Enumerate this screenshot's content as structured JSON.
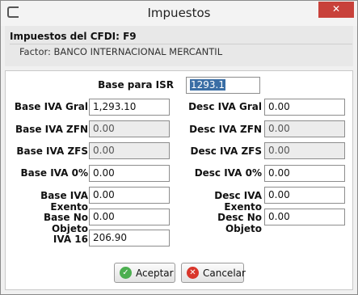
{
  "window": {
    "title": "Impuestos",
    "close_glyph": "✕"
  },
  "header": {
    "title": "Impuestos del CFDI: F9",
    "factor": "Factor: BANCO INTERNACIONAL MERCANTIL"
  },
  "form": {
    "base_isr": {
      "label": "Base para ISR",
      "value": "1293.1"
    },
    "left": [
      {
        "label": "Base IVA Gral",
        "value": "1,293.10",
        "enabled": true
      },
      {
        "label": "Base IVA ZFN",
        "value": "0.00",
        "enabled": false
      },
      {
        "label": "Base IVA ZFS",
        "value": "0.00",
        "enabled": false
      },
      {
        "label": "Base IVA 0%",
        "value": "0.00",
        "enabled": true
      },
      {
        "label": "Base IVA Exento",
        "value": "0.00",
        "enabled": true
      },
      {
        "label": "Base No Objeto",
        "value": "0.00",
        "enabled": true
      },
      {
        "label": "IVA 16",
        "value": "206.90",
        "enabled": true
      }
    ],
    "right": [
      {
        "label": "Desc IVA Gral",
        "value": "0.00",
        "enabled": true
      },
      {
        "label": "Desc IVA ZFN",
        "value": "0.00",
        "enabled": false
      },
      {
        "label": "Desc IVA ZFS",
        "value": "0.00",
        "enabled": false
      },
      {
        "label": "Desc IVA 0%",
        "value": "0.00",
        "enabled": true
      },
      {
        "label": "Desc IVA Exento",
        "value": "0.00",
        "enabled": true
      },
      {
        "label": "Desc No Objeto",
        "value": "0.00",
        "enabled": true
      }
    ]
  },
  "buttons": {
    "accept": {
      "label": "Aceptar",
      "icon": "check-circle-icon",
      "color": "#4caf50"
    },
    "cancel": {
      "label": "Cancelar",
      "icon": "x-circle-icon",
      "color": "#d9362b"
    }
  }
}
